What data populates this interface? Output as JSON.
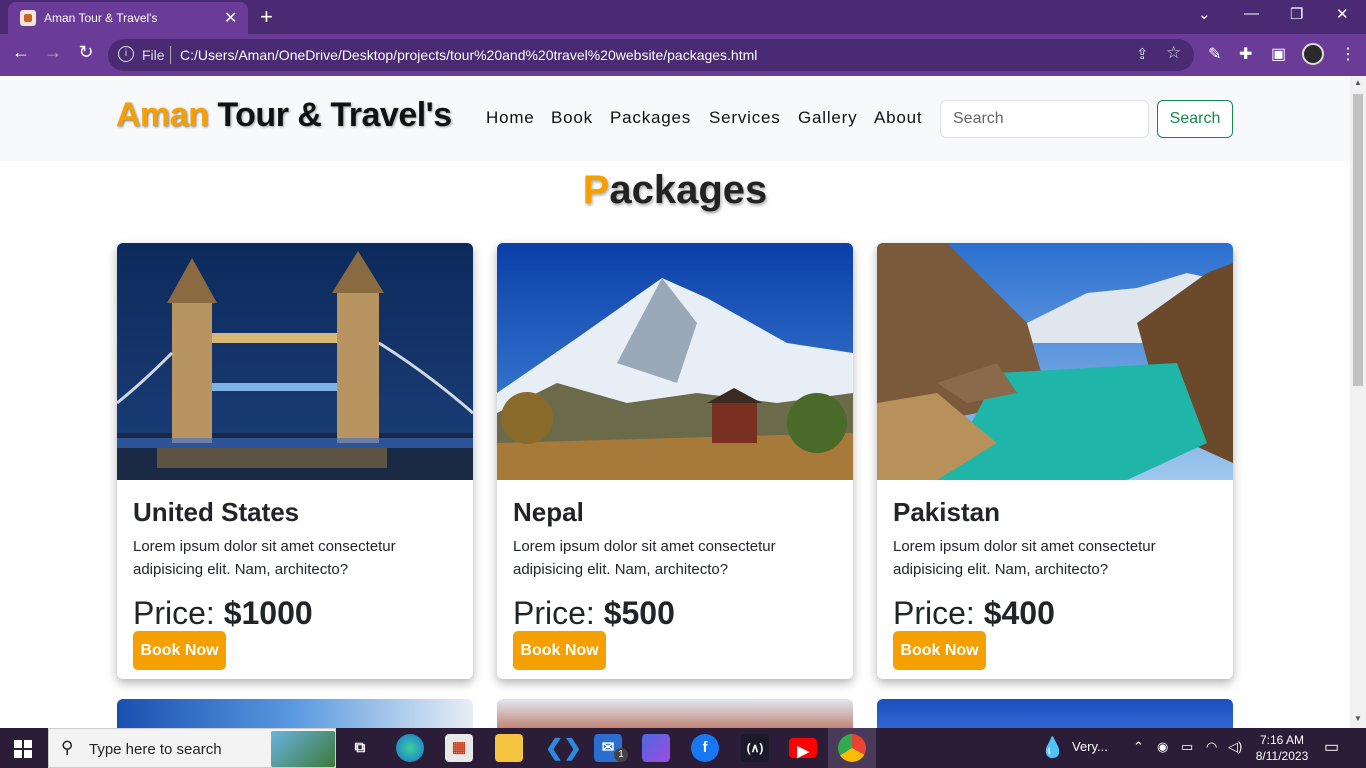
{
  "browser": {
    "tab_title": "Aman Tour & Travel's",
    "tab_close": "✕",
    "new_tab": "+",
    "url_scheme_label": "File",
    "url": "C:/Users/Aman/OneDrive/Desktop/projects/tour%20and%20travel%20website/packages.html"
  },
  "site": {
    "brand_first": "Aman",
    "brand_rest": " Tour & Travel's",
    "nav": [
      "Home",
      "Book",
      "Packages",
      "Services",
      "Gallery",
      "About"
    ],
    "search_placeholder": "Search",
    "search_button": "Search"
  },
  "page": {
    "heading_first": "P",
    "heading_rest": "ackages",
    "cards": [
      {
        "name": "United States",
        "desc": "Lorem ipsum dolor sit amet consectetur adipisicing elit. Nam, architecto?",
        "price_label": "Price: ",
        "price": "$1000",
        "button": "Book Now"
      },
      {
        "name": "Nepal",
        "desc": "Lorem ipsum dolor sit amet consectetur adipisicing elit. Nam, architecto?",
        "price_label": "Price: ",
        "price": "$500",
        "button": "Book Now"
      },
      {
        "name": "Pakistan",
        "desc": "Lorem ipsum dolor sit amet consectetur adipisicing elit. Nam, architecto?",
        "price_label": "Price: ",
        "price": "$400",
        "button": "Book Now"
      }
    ]
  },
  "taskbar": {
    "search_text": "Type here to search",
    "weather": "Very...",
    "time": "7:16 AM",
    "date": "8/11/2023",
    "mail_badge": "1"
  },
  "colors": {
    "accent": "#f5a000",
    "chrome": "#6a3b97",
    "search_green": "#198754"
  }
}
